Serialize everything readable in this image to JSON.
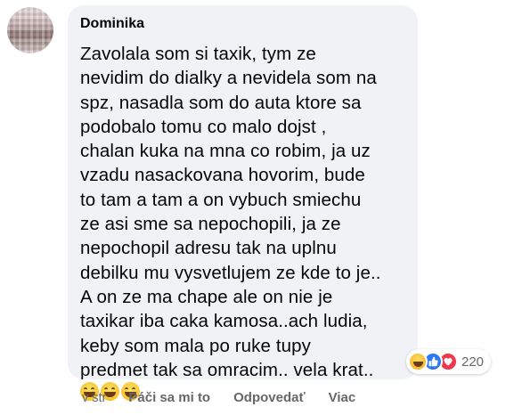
{
  "comment": {
    "author": "Dominika",
    "text": "Zavolala som si taxik, tym ze\nnevidim do dialky a nevidela som na\nspz, nasadla som do auta ktore sa\npodobalo tomu co malo dojst ,\nchalan kuka na mna co robim, ja uz\nvzadu nasackovana hovorim, bude\nto tam a tam a on vybuch smiechu\nze asi sme sa nepochopili, ja ze\nnepochopil adresu tak na uplnu\ndebilku mu vysvetlujem ze kde to je..\nA on ze ma chape ale on nie je\ntaxikar iba caka kamosa..ach ludia,\nkeby som mala po ruke tupy\npredmet tak sa omracim.. vela krat..",
    "emojis": [
      "grinning-squint-emoji",
      "grinning-squint-emoji",
      "grinning-squint-emoji"
    ]
  },
  "reactions": {
    "icons": [
      "haha",
      "like",
      "love"
    ],
    "count": "220",
    "colors": {
      "like": "#2e78f0",
      "love": "#f0384c",
      "haha": "#f7b125"
    }
  },
  "actions": {
    "time": "v str",
    "like": "Páči sa mi to",
    "reply": "Odpovedať",
    "more": "Viac"
  },
  "theme": {
    "bubble_bg": "#f0f2f5",
    "text_color": "#050505",
    "secondary_text": "#65676b"
  }
}
